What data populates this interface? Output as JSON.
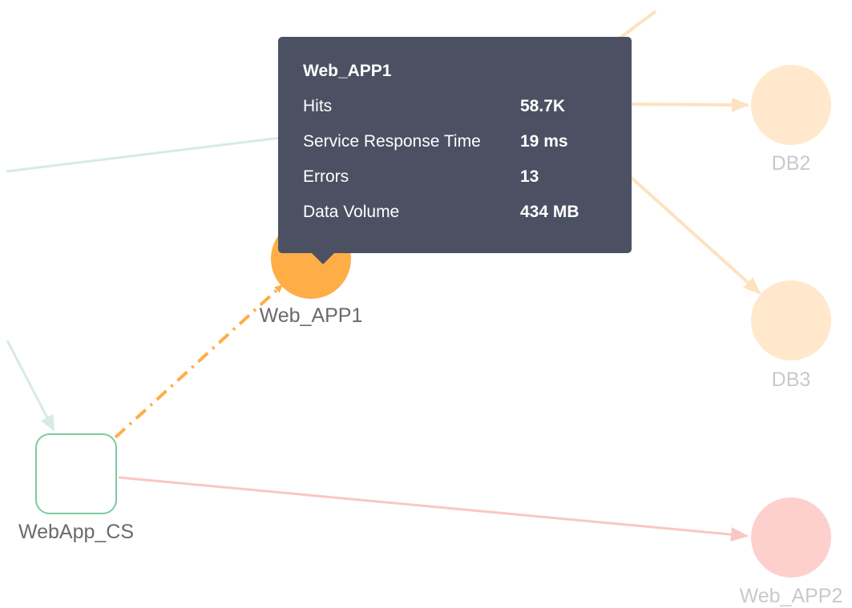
{
  "colors": {
    "active_node": "#ffad47",
    "faded_node": "#ffe8cc",
    "error_node": "#fdd0ce",
    "orange_edge": "#ffad47",
    "faded_orange_edge": "#fde2c0",
    "green_edge": "#d6ece2",
    "red_edge": "#f9c7c4",
    "cs_border": "#7ccaa0",
    "tooltip_bg": "#4b5163"
  },
  "nodes": {
    "web_app1": {
      "label": "Web_APP1",
      "icon": "circle-node-icon"
    },
    "db2": {
      "label": "DB2",
      "icon": "circle-node-icon"
    },
    "db3": {
      "label": "DB3",
      "icon": "circle-node-icon"
    },
    "web_app2": {
      "label": "Web_APP2",
      "icon": "circle-node-icon"
    },
    "webapp_cs": {
      "label": "WebApp_CS",
      "icon": "rounded-square-node-icon"
    }
  },
  "tooltip": {
    "title": "Web_APP1",
    "rows": [
      {
        "label": "Hits",
        "value": "58.7K"
      },
      {
        "label": "Service Response Time",
        "value": "19 ms"
      },
      {
        "label": "Errors",
        "value": "13"
      },
      {
        "label": "Data Volume",
        "value": "434 MB"
      }
    ]
  }
}
